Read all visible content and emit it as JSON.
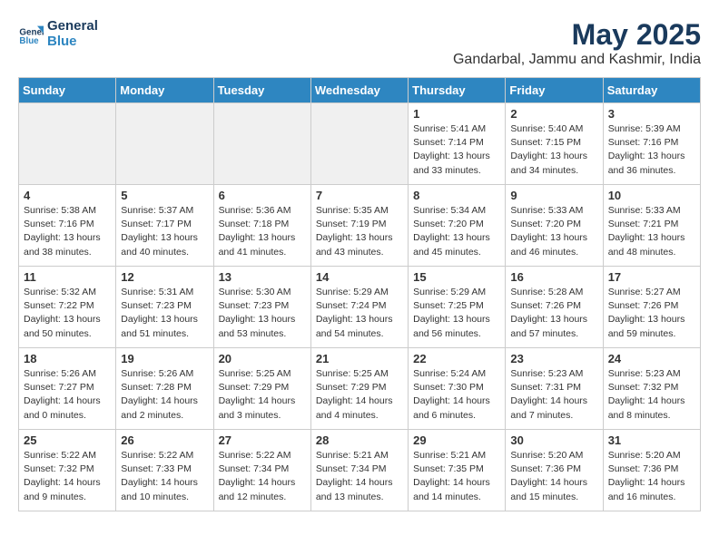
{
  "logo": {
    "line1": "General",
    "line2": "Blue"
  },
  "title": "May 2025",
  "location": "Gandarbal, Jammu and Kashmir, India",
  "days_of_week": [
    "Sunday",
    "Monday",
    "Tuesday",
    "Wednesday",
    "Thursday",
    "Friday",
    "Saturday"
  ],
  "weeks": [
    [
      {
        "num": "",
        "info": "",
        "empty": true
      },
      {
        "num": "",
        "info": "",
        "empty": true
      },
      {
        "num": "",
        "info": "",
        "empty": true
      },
      {
        "num": "",
        "info": "",
        "empty": true
      },
      {
        "num": "1",
        "info": "Sunrise: 5:41 AM\nSunset: 7:14 PM\nDaylight: 13 hours\nand 33 minutes.",
        "empty": false
      },
      {
        "num": "2",
        "info": "Sunrise: 5:40 AM\nSunset: 7:15 PM\nDaylight: 13 hours\nand 34 minutes.",
        "empty": false
      },
      {
        "num": "3",
        "info": "Sunrise: 5:39 AM\nSunset: 7:16 PM\nDaylight: 13 hours\nand 36 minutes.",
        "empty": false
      }
    ],
    [
      {
        "num": "4",
        "info": "Sunrise: 5:38 AM\nSunset: 7:16 PM\nDaylight: 13 hours\nand 38 minutes.",
        "empty": false
      },
      {
        "num": "5",
        "info": "Sunrise: 5:37 AM\nSunset: 7:17 PM\nDaylight: 13 hours\nand 40 minutes.",
        "empty": false
      },
      {
        "num": "6",
        "info": "Sunrise: 5:36 AM\nSunset: 7:18 PM\nDaylight: 13 hours\nand 41 minutes.",
        "empty": false
      },
      {
        "num": "7",
        "info": "Sunrise: 5:35 AM\nSunset: 7:19 PM\nDaylight: 13 hours\nand 43 minutes.",
        "empty": false
      },
      {
        "num": "8",
        "info": "Sunrise: 5:34 AM\nSunset: 7:20 PM\nDaylight: 13 hours\nand 45 minutes.",
        "empty": false
      },
      {
        "num": "9",
        "info": "Sunrise: 5:33 AM\nSunset: 7:20 PM\nDaylight: 13 hours\nand 46 minutes.",
        "empty": false
      },
      {
        "num": "10",
        "info": "Sunrise: 5:33 AM\nSunset: 7:21 PM\nDaylight: 13 hours\nand 48 minutes.",
        "empty": false
      }
    ],
    [
      {
        "num": "11",
        "info": "Sunrise: 5:32 AM\nSunset: 7:22 PM\nDaylight: 13 hours\nand 50 minutes.",
        "empty": false
      },
      {
        "num": "12",
        "info": "Sunrise: 5:31 AM\nSunset: 7:23 PM\nDaylight: 13 hours\nand 51 minutes.",
        "empty": false
      },
      {
        "num": "13",
        "info": "Sunrise: 5:30 AM\nSunset: 7:23 PM\nDaylight: 13 hours\nand 53 minutes.",
        "empty": false
      },
      {
        "num": "14",
        "info": "Sunrise: 5:29 AM\nSunset: 7:24 PM\nDaylight: 13 hours\nand 54 minutes.",
        "empty": false
      },
      {
        "num": "15",
        "info": "Sunrise: 5:29 AM\nSunset: 7:25 PM\nDaylight: 13 hours\nand 56 minutes.",
        "empty": false
      },
      {
        "num": "16",
        "info": "Sunrise: 5:28 AM\nSunset: 7:26 PM\nDaylight: 13 hours\nand 57 minutes.",
        "empty": false
      },
      {
        "num": "17",
        "info": "Sunrise: 5:27 AM\nSunset: 7:26 PM\nDaylight: 13 hours\nand 59 minutes.",
        "empty": false
      }
    ],
    [
      {
        "num": "18",
        "info": "Sunrise: 5:26 AM\nSunset: 7:27 PM\nDaylight: 14 hours\nand 0 minutes.",
        "empty": false
      },
      {
        "num": "19",
        "info": "Sunrise: 5:26 AM\nSunset: 7:28 PM\nDaylight: 14 hours\nand 2 minutes.",
        "empty": false
      },
      {
        "num": "20",
        "info": "Sunrise: 5:25 AM\nSunset: 7:29 PM\nDaylight: 14 hours\nand 3 minutes.",
        "empty": false
      },
      {
        "num": "21",
        "info": "Sunrise: 5:25 AM\nSunset: 7:29 PM\nDaylight: 14 hours\nand 4 minutes.",
        "empty": false
      },
      {
        "num": "22",
        "info": "Sunrise: 5:24 AM\nSunset: 7:30 PM\nDaylight: 14 hours\nand 6 minutes.",
        "empty": false
      },
      {
        "num": "23",
        "info": "Sunrise: 5:23 AM\nSunset: 7:31 PM\nDaylight: 14 hours\nand 7 minutes.",
        "empty": false
      },
      {
        "num": "24",
        "info": "Sunrise: 5:23 AM\nSunset: 7:32 PM\nDaylight: 14 hours\nand 8 minutes.",
        "empty": false
      }
    ],
    [
      {
        "num": "25",
        "info": "Sunrise: 5:22 AM\nSunset: 7:32 PM\nDaylight: 14 hours\nand 9 minutes.",
        "empty": false
      },
      {
        "num": "26",
        "info": "Sunrise: 5:22 AM\nSunset: 7:33 PM\nDaylight: 14 hours\nand 10 minutes.",
        "empty": false
      },
      {
        "num": "27",
        "info": "Sunrise: 5:22 AM\nSunset: 7:34 PM\nDaylight: 14 hours\nand 12 minutes.",
        "empty": false
      },
      {
        "num": "28",
        "info": "Sunrise: 5:21 AM\nSunset: 7:34 PM\nDaylight: 14 hours\nand 13 minutes.",
        "empty": false
      },
      {
        "num": "29",
        "info": "Sunrise: 5:21 AM\nSunset: 7:35 PM\nDaylight: 14 hours\nand 14 minutes.",
        "empty": false
      },
      {
        "num": "30",
        "info": "Sunrise: 5:20 AM\nSunset: 7:36 PM\nDaylight: 14 hours\nand 15 minutes.",
        "empty": false
      },
      {
        "num": "31",
        "info": "Sunrise: 5:20 AM\nSunset: 7:36 PM\nDaylight: 14 hours\nand 16 minutes.",
        "empty": false
      }
    ]
  ]
}
